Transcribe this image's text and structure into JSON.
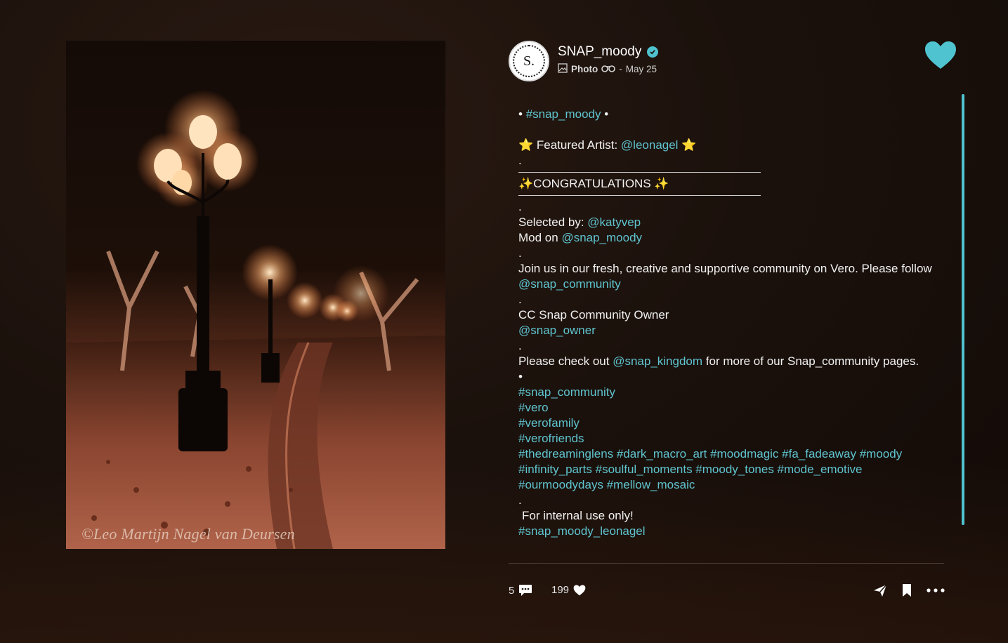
{
  "post": {
    "photo_watermark": "©Leo Martijn Nagel van Deursen",
    "author": {
      "username": "SNAP_moody",
      "avatar_letter": "S.",
      "verified": true
    },
    "meta": {
      "type": "Photo",
      "separator": "-",
      "date": "May 25"
    },
    "caption": {
      "hashtag_head": "#snap_moody",
      "bullet": "•",
      "featured_label": "Featured Artist:",
      "featured_handle": "@leonagel",
      "star": "⭐",
      "dot": ".",
      "congrats": "✨CONGRATULATIONS ✨",
      "selected_label": "Selected by:",
      "selected_handle": "@katyvep",
      "mod_label": "Mod on",
      "mod_handle": "@snap_moody",
      "join_text": "Join us in our fresh, creative and supportive community on Vero. Please follow",
      "join_handle": "@snap_community",
      "owner_label": "CC Snap Community Owner",
      "owner_handle": "@snap_owner",
      "check_pre": "Please check out",
      "check_handle": "@snap_kingdom",
      "check_post": "for more of our Snap_community pages.",
      "tags": [
        "#snap_community",
        "#vero",
        "#verofamily",
        "#verofriends",
        "#thedreaminglens #dark_macro_art #moodmagic #fa_fadeaway #moody",
        "#infinity_parts #soulful_moments #moody_tones #mode_emotive",
        "#ourmoodydays #mellow_mosaic"
      ],
      "internal": "For internal use only!",
      "last_tag": "#snap_moody_leonagel"
    },
    "stats": {
      "comments": "5",
      "likes": "199"
    }
  },
  "colors": {
    "accent": "#4fc3cf",
    "link": "#5fc4cf"
  }
}
